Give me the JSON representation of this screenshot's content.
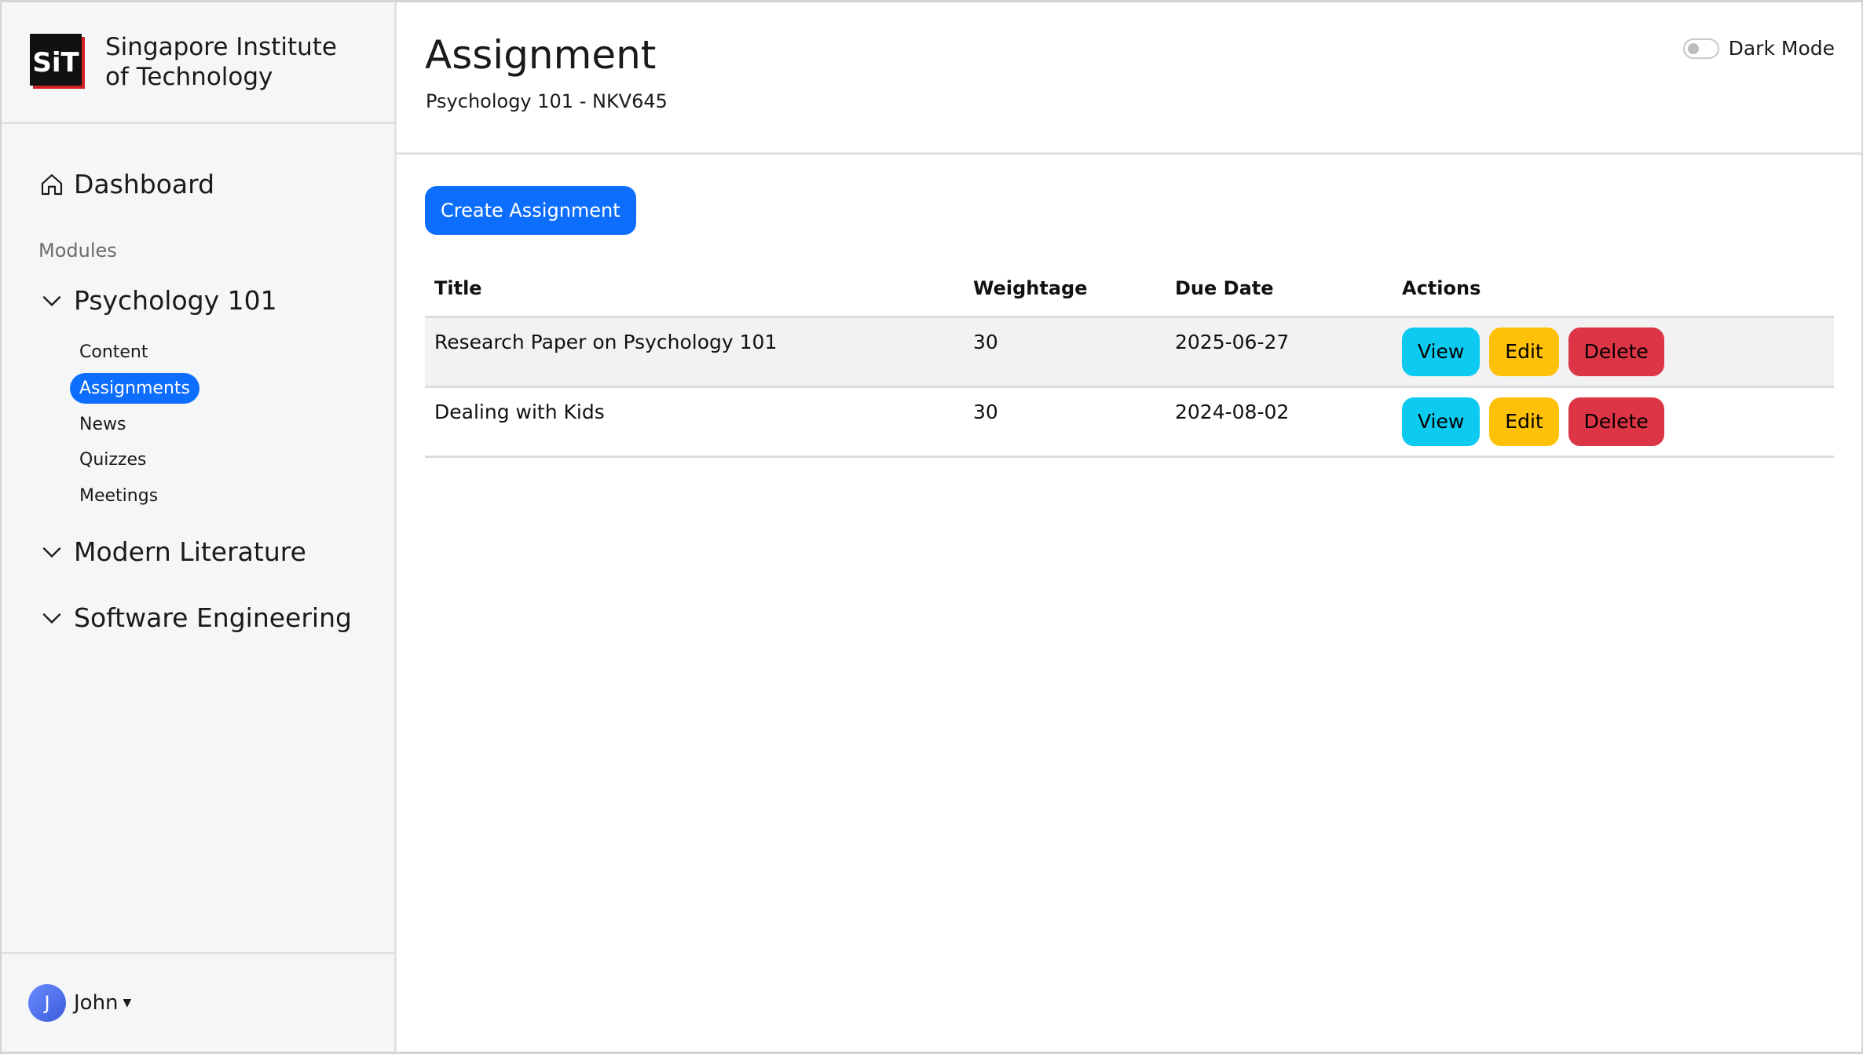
{
  "brand": {
    "logo_text": "SiT",
    "name": "Singapore Institute of Technology"
  },
  "sidebar": {
    "dashboard_label": "Dashboard",
    "section_label": "Modules",
    "modules": [
      {
        "label": "Psychology 101",
        "expanded": true,
        "items": [
          {
            "label": "Content",
            "active": false
          },
          {
            "label": "Assignments",
            "active": true
          },
          {
            "label": "News",
            "active": false
          },
          {
            "label": "Quizzes",
            "active": false
          },
          {
            "label": "Meetings",
            "active": false
          }
        ]
      },
      {
        "label": "Modern Literature",
        "expanded": false
      },
      {
        "label": "Software Engineering",
        "expanded": false
      }
    ]
  },
  "user": {
    "initial": "J",
    "name": "John"
  },
  "header": {
    "title": "Assignment",
    "subtitle": "Psychology 101 - NKV645",
    "dark_mode_label": "Dark Mode",
    "dark_mode_on": false
  },
  "main": {
    "create_button_label": "Create Assignment",
    "table": {
      "columns": [
        "Title",
        "Weightage",
        "Due Date",
        "Actions"
      ],
      "rows": [
        {
          "title": "Research Paper on Psychology 101",
          "weightage": "30",
          "due_date": "2025-06-27"
        },
        {
          "title": "Dealing with Kids",
          "weightage": "30",
          "due_date": "2024-08-02"
        }
      ],
      "actions": {
        "view": "View",
        "edit": "Edit",
        "delete": "Delete"
      }
    }
  },
  "colors": {
    "primary": "#0d6efd",
    "view": "#0dcaf0",
    "edit": "#ffc107",
    "delete": "#dc3545",
    "sidebar_bg": "#f5f6f8"
  }
}
